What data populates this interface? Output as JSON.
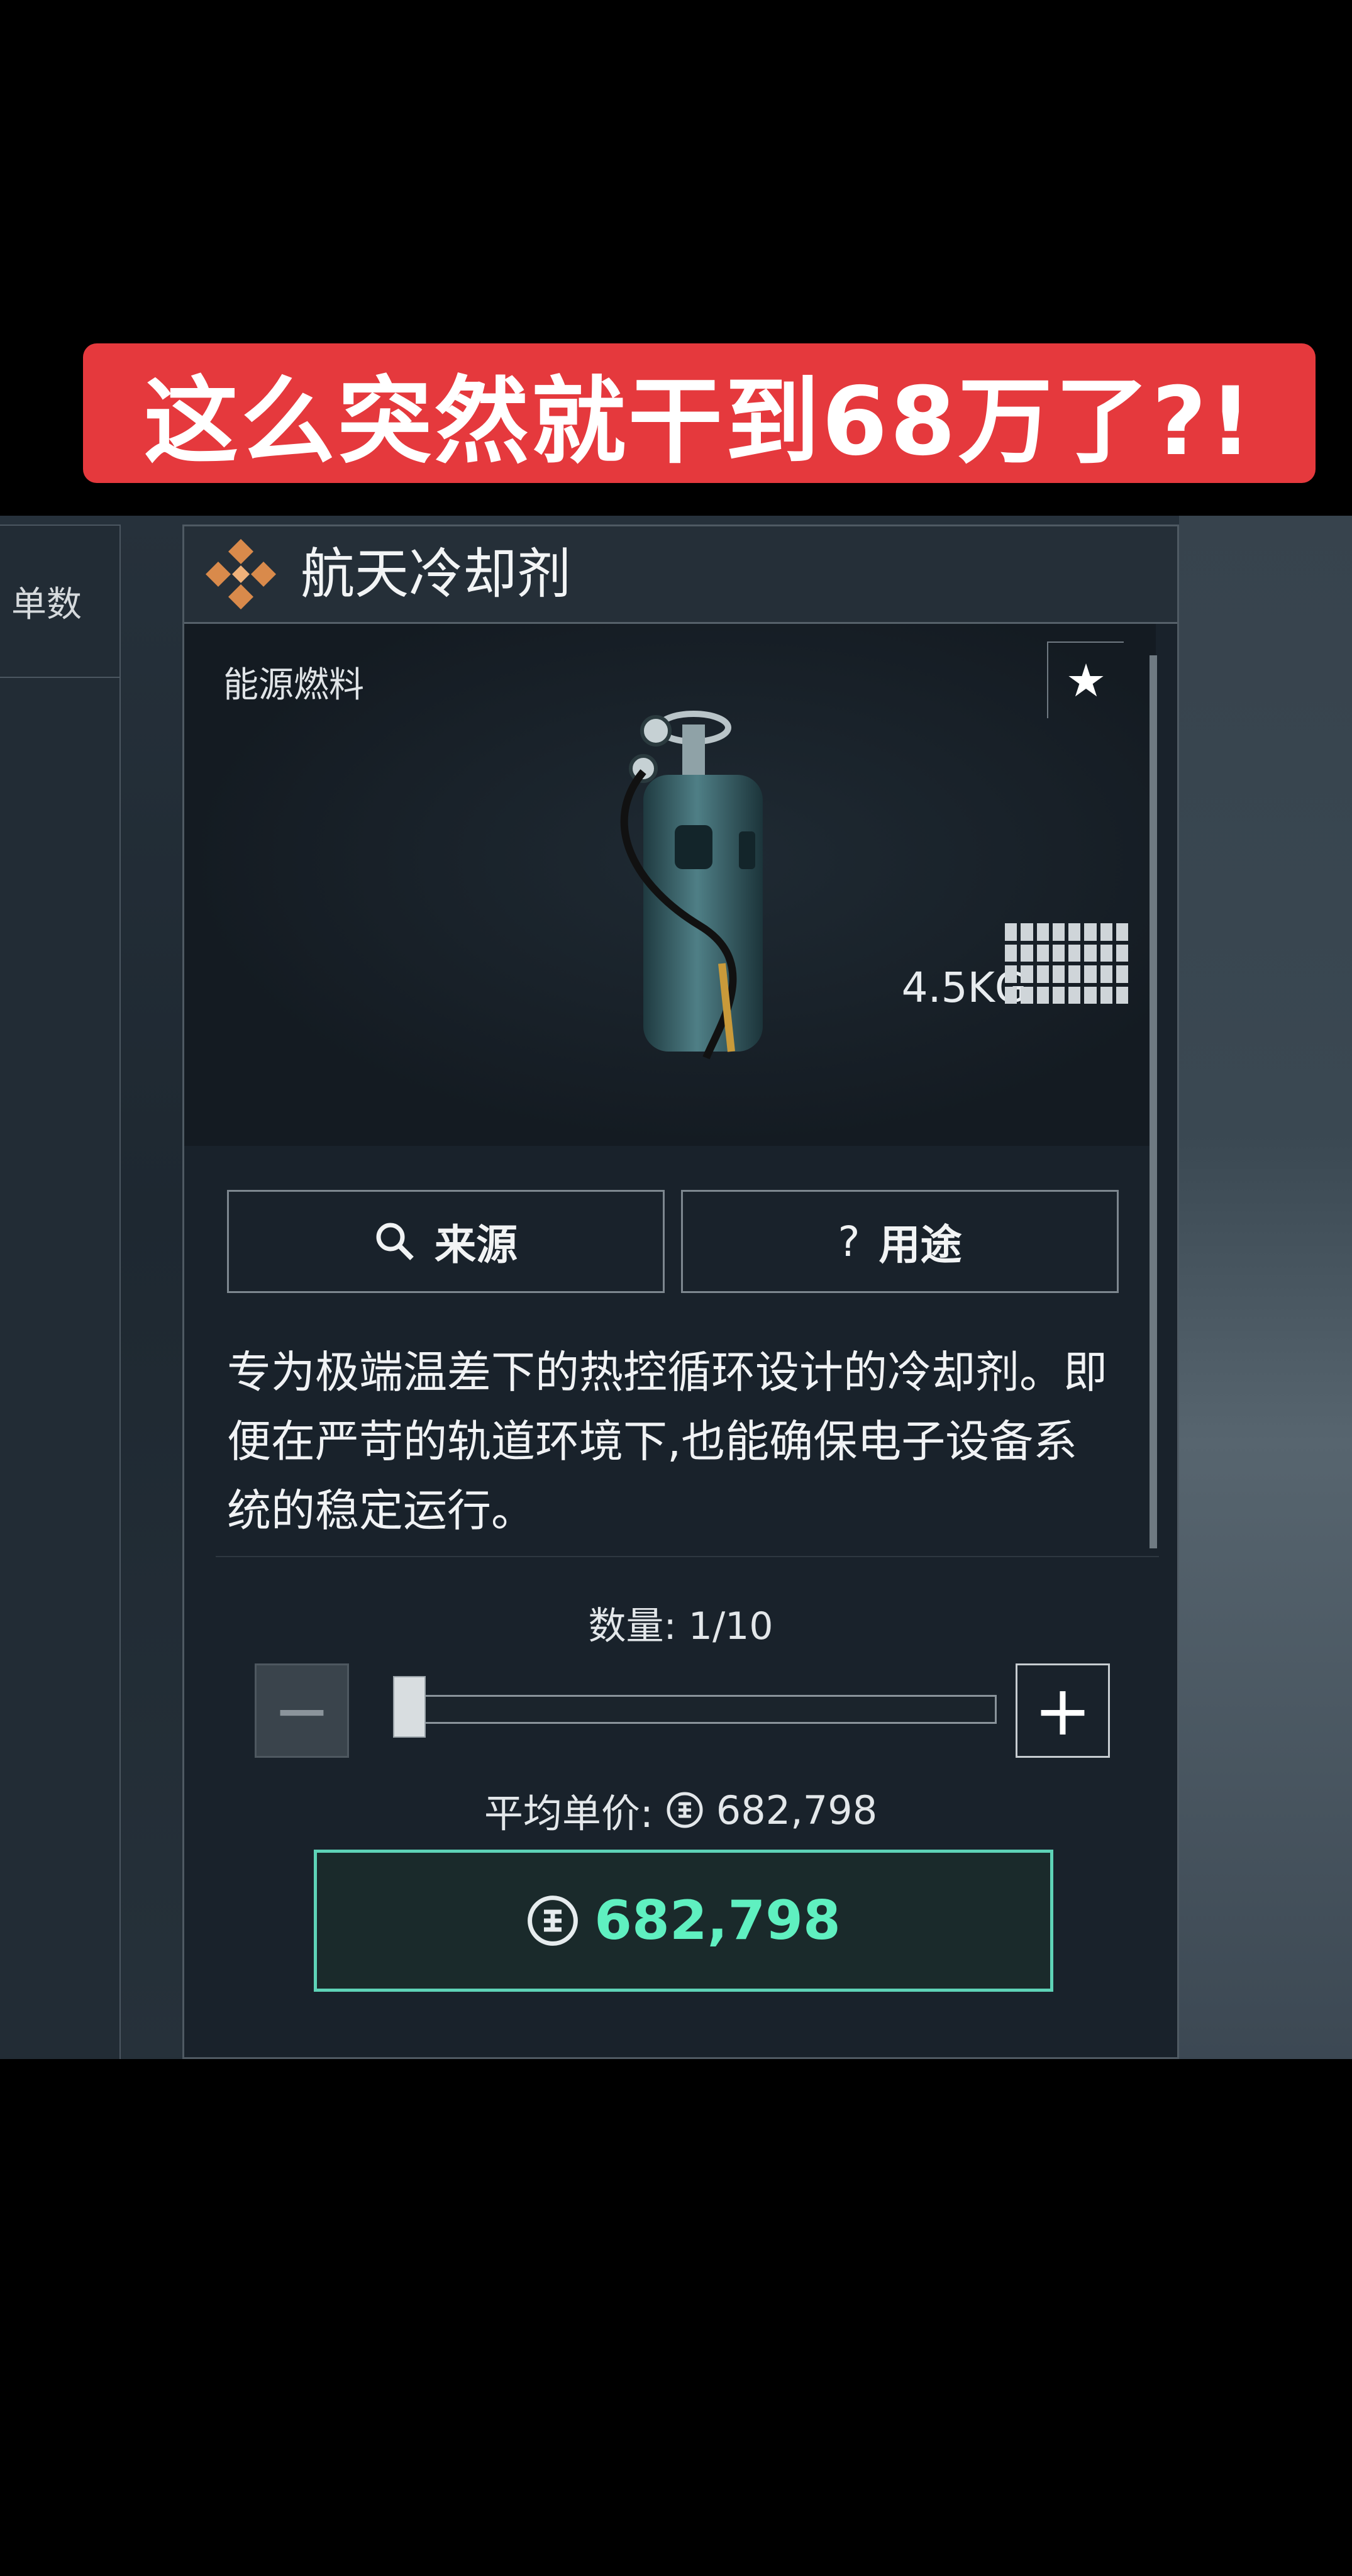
{
  "banner": {
    "text": "这么突然就干到68万了?!",
    "color": "#e5393d"
  },
  "left_panel": {
    "header_fragment": "单数"
  },
  "item": {
    "title": "航天冷却剂",
    "category": "能源燃料",
    "weight": "4.5KG",
    "icon": "cylinder-image",
    "description": "专为极端温差下的热控循环设计的冷却剂。即便在严苛的轨道环境下,也能确保电子设备系统的稳定运行。"
  },
  "buttons": {
    "source": "来源",
    "usage": "用途"
  },
  "quantity": {
    "label": "数量: 1/10",
    "current": 1,
    "max": 10
  },
  "price": {
    "avg_label": "平均单价:",
    "avg_value": "682,798",
    "total": "682,798",
    "accent": "#5ff0c0"
  }
}
